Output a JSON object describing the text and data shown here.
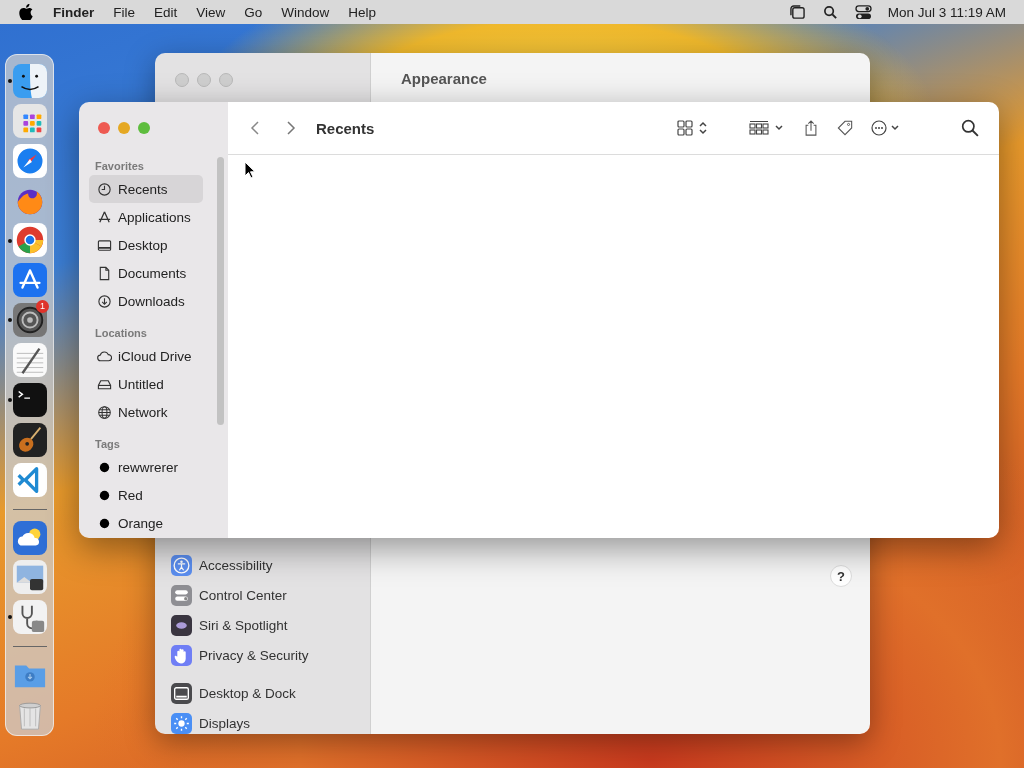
{
  "menu_bar": {
    "app_name": "Finder",
    "menus": [
      "File",
      "Edit",
      "View",
      "Go",
      "Window",
      "Help"
    ],
    "clock": "Mon Jul 3 11:19 AM"
  },
  "dock": {
    "items": [
      {
        "kind": "finder",
        "running": true
      },
      {
        "kind": "launchpad",
        "running": false
      },
      {
        "kind": "compass",
        "running": false
      },
      {
        "kind": "fox",
        "running": false
      },
      {
        "kind": "chrome",
        "running": true
      },
      {
        "kind": "appstore",
        "running": false
      },
      {
        "kind": "settings",
        "running": true,
        "badge": "1"
      },
      {
        "kind": "notepad",
        "running": false
      },
      {
        "kind": "terminal",
        "running": true
      },
      {
        "kind": "guitar",
        "running": false
      },
      {
        "kind": "code",
        "running": false
      },
      {
        "kind": "separator"
      },
      {
        "kind": "weather",
        "running": false
      },
      {
        "kind": "preview",
        "running": false
      },
      {
        "kind": "stethoscope",
        "running": true
      },
      {
        "kind": "separator"
      },
      {
        "kind": "folder",
        "running": false
      },
      {
        "kind": "trash",
        "running": false
      }
    ]
  },
  "settings_window": {
    "title": "Appearance",
    "help": "?",
    "sidebar_groups": [
      {
        "items": [
          {
            "label": "Accessibility",
            "kind": "accessibility"
          },
          {
            "label": "Control Center",
            "kind": "control"
          },
          {
            "label": "Siri & Spotlight",
            "kind": "siri"
          },
          {
            "label": "Privacy & Security",
            "kind": "privacy"
          }
        ]
      },
      {
        "items": [
          {
            "label": "Desktop & Dock",
            "kind": "dock"
          },
          {
            "label": "Displays",
            "kind": "displays"
          }
        ]
      }
    ]
  },
  "finder_window": {
    "title": "Recents",
    "sidebar": [
      {
        "heading": "Favorites",
        "items": [
          {
            "label": "Recents",
            "kind": "clock",
            "selected": true
          },
          {
            "label": "Applications",
            "kind": "apps",
            "selected": false
          },
          {
            "label": "Desktop",
            "kind": "desktop",
            "selected": false
          },
          {
            "label": "Documents",
            "kind": "document",
            "selected": false
          },
          {
            "label": "Downloads",
            "kind": "download",
            "selected": false
          }
        ]
      },
      {
        "heading": "Locations",
        "items": [
          {
            "label": "iCloud Drive",
            "kind": "cloud",
            "selected": false
          },
          {
            "label": "Untitled",
            "kind": "disk",
            "selected": false
          },
          {
            "label": "Network",
            "kind": "globe",
            "selected": false
          }
        ]
      },
      {
        "heading": "Tags",
        "items": [
          {
            "label": "rewwrerer",
            "kind": "tag",
            "selected": false
          },
          {
            "label": "Red",
            "kind": "tag",
            "selected": false
          },
          {
            "label": "Orange",
            "kind": "tag",
            "selected": false
          }
        ]
      }
    ]
  }
}
